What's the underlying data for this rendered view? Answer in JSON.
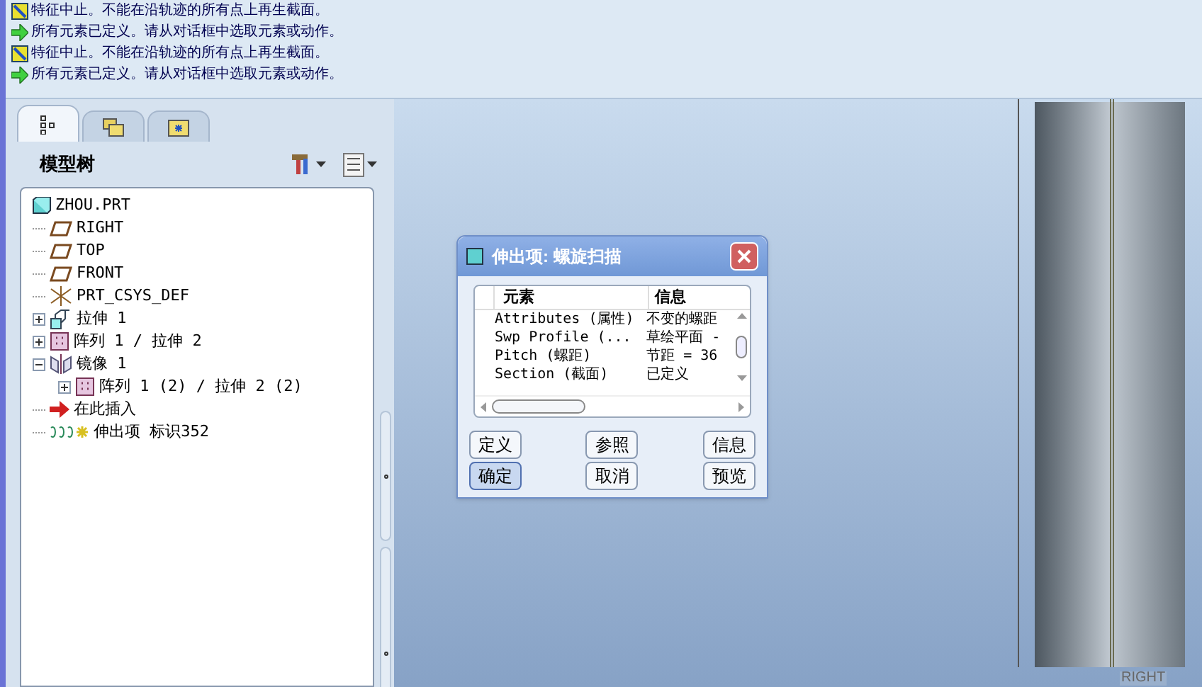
{
  "messages": [
    {
      "kind": "stop",
      "text": "特征中止。不能在沿轨迹的所有点上再生截面。"
    },
    {
      "kind": "prompt",
      "text": "所有元素已定义。请从对话框中选取元素或动作。"
    },
    {
      "kind": "stop",
      "text": "特征中止。不能在沿轨迹的所有点上再生截面。"
    },
    {
      "kind": "prompt",
      "text": "所有元素已定义。请从对话框中选取元素或动作。"
    }
  ],
  "navigator": {
    "tabs": [
      {
        "kind": "tree",
        "selected": true
      },
      {
        "kind": "folders",
        "selected": false
      },
      {
        "kind": "favorites",
        "selected": false
      }
    ],
    "title": "模型树",
    "tree": [
      {
        "kind": "part",
        "label": "ZHOU.PRT",
        "children": [
          {
            "kind": "plane",
            "label": "RIGHT"
          },
          {
            "kind": "plane",
            "label": "TOP"
          },
          {
            "kind": "plane",
            "label": "FRONT"
          },
          {
            "kind": "csys",
            "label": "PRT_CSYS_DEF"
          },
          {
            "kind": "extrude",
            "label": "拉伸 1",
            "expanded": false
          },
          {
            "kind": "pattern",
            "label": "阵列 1 / 拉伸 2",
            "expanded": false
          },
          {
            "kind": "mirror",
            "label": "镜像 1",
            "expanded": true,
            "children": [
              {
                "kind": "pattern",
                "label": "阵列 1 (2) / 拉伸 2 (2)",
                "expanded": false
              }
            ]
          },
          {
            "kind": "insert",
            "label": "在此插入"
          },
          {
            "kind": "sweep",
            "label": "伸出项 标识352"
          }
        ]
      }
    ]
  },
  "dialog": {
    "title": "伸出项: 螺旋扫描",
    "columns": [
      "元素",
      "信息"
    ],
    "rows": [
      {
        "element": "Attributes (属性)",
        "info": "不变的螺距"
      },
      {
        "element": "Swp Profile (...",
        "info": "草绘平面 -"
      },
      {
        "element": "Pitch (螺距)",
        "info": "节距 = 36"
      },
      {
        "element": "Section (截面)",
        "info": "已定义"
      }
    ],
    "buttons": [
      {
        "label": "定义",
        "focused": false
      },
      {
        "label": "参照",
        "focused": false
      },
      {
        "label": "信息",
        "focused": false
      },
      {
        "label": "确定",
        "focused": true
      },
      {
        "label": "取消",
        "focused": false
      },
      {
        "label": "预览",
        "focused": false
      }
    ]
  },
  "viewport": {
    "datum_label": "RIGHT"
  }
}
